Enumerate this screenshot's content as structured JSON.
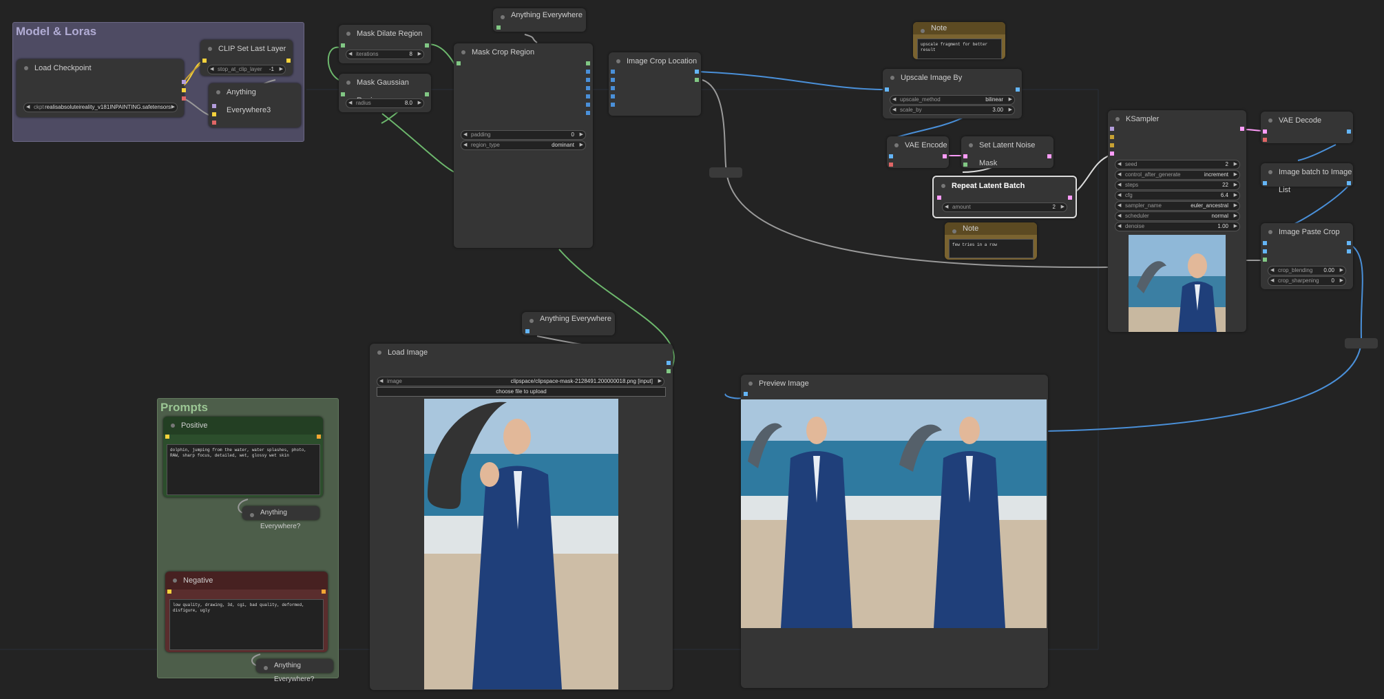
{
  "groups": {
    "model_loras": "Model & Loras",
    "prompts": "Prompts"
  },
  "nodes": {
    "load_checkpoint": {
      "title": "Load Checkpoint",
      "ckpt_label": "ckpt",
      "ckpt_value": "realisabsoluteireality_v181INPAINTING.safetensors"
    },
    "clip_set_last_layer": {
      "title": "CLIP Set Last Layer",
      "label": "stop_at_clip_layer",
      "value": "-1"
    },
    "anything_everywhere3": {
      "title": "Anything Everywhere3"
    },
    "mask_dilate": {
      "title": "Mask Dilate Region",
      "label": "iterations",
      "value": "8"
    },
    "mask_gaussian": {
      "title": "Mask Gaussian Region",
      "label": "radius",
      "value": "8.0"
    },
    "anything_everywhere_top": {
      "title": "Anything Everywhere"
    },
    "mask_crop": {
      "title": "Mask Crop Region",
      "padding_label": "padding",
      "padding_value": "0",
      "region_label": "region_type",
      "region_value": "dominant"
    },
    "image_crop_location": {
      "title": "Image Crop Location"
    },
    "note_top": {
      "title": "Note",
      "text": "upscale fragment for better result"
    },
    "upscale": {
      "title": "Upscale Image By",
      "method_label": "upscale_method",
      "method_value": "bilinear",
      "scale_label": "scale_by",
      "scale_value": "3.00"
    },
    "vae_encode": {
      "title": "VAE Encode"
    },
    "set_latent_noise_mask": {
      "title": "Set Latent Noise Mask"
    },
    "repeat_latent_batch": {
      "title": "Repeat Latent Batch",
      "label": "amount",
      "value": "2"
    },
    "note_bottom": {
      "title": "Note",
      "text": "few tries in a row"
    },
    "ksampler": {
      "title": "KSampler",
      "widgets": [
        {
          "label": "seed",
          "value": "2"
        },
        {
          "label": "control_after_generate",
          "value": "increment"
        },
        {
          "label": "steps",
          "value": "22"
        },
        {
          "label": "cfg",
          "value": "6.4"
        },
        {
          "label": "sampler_name",
          "value": "euler_ancestral"
        },
        {
          "label": "scheduler",
          "value": "normal"
        },
        {
          "label": "denoise",
          "value": "1.00"
        }
      ]
    },
    "vae_decode": {
      "title": "VAE Decode"
    },
    "image_batch_to_list": {
      "title": "Image batch to Image List"
    },
    "image_paste_crop": {
      "title": "Image Paste Crop",
      "blend_label": "crop_blending",
      "blend_value": "0.00",
      "sharp_label": "crop_sharpening",
      "sharp_value": "0"
    },
    "anything_everywhere_mid": {
      "title": "Anything Everywhere"
    },
    "load_image": {
      "title": "Load Image",
      "image_label": "image",
      "image_value": "clipspace/clipspace-mask-2128491.200000018.png [input]",
      "upload_label": "choose file to upload"
    },
    "preview_image": {
      "title": "Preview Image"
    },
    "positive": {
      "title": "Positive",
      "text": "dolphin, jumping from the water, water splashes, photo, RAW, sharp focus, detailed, wet, glossy wet skin",
      "ae_title": "Anything Everywhere?"
    },
    "negative": {
      "title": "Negative",
      "text": "low quality, drawing, 3d, cgi, bad quality, deformed, disfigure, ugly",
      "ae_title": "Anything Everywhere?"
    }
  },
  "colors": {
    "model": "#c8a233",
    "clip": "#f5d23c",
    "vae": "#e06666",
    "image": "#64b5f6",
    "mask": "#81c784",
    "latent": "#ff9cf9",
    "wire_image": "#4a90d9",
    "wire_mask": "#6db86d",
    "wire_gray": "#9a9a9a"
  }
}
